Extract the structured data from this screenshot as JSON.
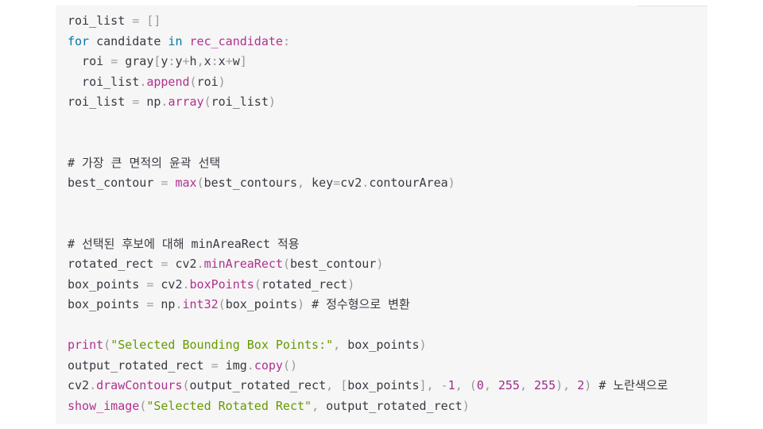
{
  "code": {
    "lines": [
      [
        {
          "c": "plain",
          "t": "roi_list "
        },
        {
          "c": "op",
          "t": "="
        },
        {
          "c": "plain",
          "t": " "
        },
        {
          "c": "punc",
          "t": "[]"
        }
      ],
      [
        {
          "c": "kw",
          "t": "for"
        },
        {
          "c": "plain",
          "t": " candidate "
        },
        {
          "c": "kw",
          "t": "in"
        },
        {
          "c": "plain",
          "t": " "
        },
        {
          "c": "fn",
          "t": "rec_candidate"
        },
        {
          "c": "punc",
          "t": ":"
        }
      ],
      [
        {
          "c": "plain",
          "t": "  roi "
        },
        {
          "c": "op",
          "t": "="
        },
        {
          "c": "plain",
          "t": " gray"
        },
        {
          "c": "punc",
          "t": "["
        },
        {
          "c": "plain",
          "t": "y"
        },
        {
          "c": "punc",
          "t": ":"
        },
        {
          "c": "plain",
          "t": "y"
        },
        {
          "c": "op",
          "t": "+"
        },
        {
          "c": "plain",
          "t": "h"
        },
        {
          "c": "punc",
          "t": ","
        },
        {
          "c": "plain",
          "t": "x"
        },
        {
          "c": "punc",
          "t": ":"
        },
        {
          "c": "plain",
          "t": "x"
        },
        {
          "c": "op",
          "t": "+"
        },
        {
          "c": "plain",
          "t": "w"
        },
        {
          "c": "punc",
          "t": "]"
        }
      ],
      [
        {
          "c": "plain",
          "t": "  roi_list"
        },
        {
          "c": "punc",
          "t": "."
        },
        {
          "c": "fn",
          "t": "append"
        },
        {
          "c": "punc",
          "t": "("
        },
        {
          "c": "plain",
          "t": "roi"
        },
        {
          "c": "punc",
          "t": ")"
        }
      ],
      [
        {
          "c": "plain",
          "t": "roi_list "
        },
        {
          "c": "op",
          "t": "="
        },
        {
          "c": "plain",
          "t": " np"
        },
        {
          "c": "punc",
          "t": "."
        },
        {
          "c": "fn",
          "t": "array"
        },
        {
          "c": "punc",
          "t": "("
        },
        {
          "c": "plain",
          "t": "roi_list"
        },
        {
          "c": "punc",
          "t": ")"
        }
      ],
      [],
      [],
      [
        {
          "c": "comment",
          "t": "# 가장 큰 면적의 윤곽 선택"
        }
      ],
      [
        {
          "c": "plain",
          "t": "best_contour "
        },
        {
          "c": "op",
          "t": "="
        },
        {
          "c": "plain",
          "t": " "
        },
        {
          "c": "fn",
          "t": "max"
        },
        {
          "c": "punc",
          "t": "("
        },
        {
          "c": "plain",
          "t": "best_contours"
        },
        {
          "c": "punc",
          "t": ","
        },
        {
          "c": "plain",
          "t": " key"
        },
        {
          "c": "op",
          "t": "="
        },
        {
          "c": "plain",
          "t": "cv2"
        },
        {
          "c": "punc",
          "t": "."
        },
        {
          "c": "plain",
          "t": "contourArea"
        },
        {
          "c": "punc",
          "t": ")"
        }
      ],
      [],
      [],
      [
        {
          "c": "comment",
          "t": "# 선택된 후보에 대해 minAreaRect 적용"
        }
      ],
      [
        {
          "c": "plain",
          "t": "rotated_rect "
        },
        {
          "c": "op",
          "t": "="
        },
        {
          "c": "plain",
          "t": " cv2"
        },
        {
          "c": "punc",
          "t": "."
        },
        {
          "c": "fn",
          "t": "minAreaRect"
        },
        {
          "c": "punc",
          "t": "("
        },
        {
          "c": "plain",
          "t": "best_contour"
        },
        {
          "c": "punc",
          "t": ")"
        }
      ],
      [
        {
          "c": "plain",
          "t": "box_points "
        },
        {
          "c": "op",
          "t": "="
        },
        {
          "c": "plain",
          "t": " cv2"
        },
        {
          "c": "punc",
          "t": "."
        },
        {
          "c": "fn",
          "t": "boxPoints"
        },
        {
          "c": "punc",
          "t": "("
        },
        {
          "c": "plain",
          "t": "rotated_rect"
        },
        {
          "c": "punc",
          "t": ")"
        }
      ],
      [
        {
          "c": "plain",
          "t": "box_points "
        },
        {
          "c": "op",
          "t": "="
        },
        {
          "c": "plain",
          "t": " np"
        },
        {
          "c": "punc",
          "t": "."
        },
        {
          "c": "fn",
          "t": "int32"
        },
        {
          "c": "punc",
          "t": "("
        },
        {
          "c": "plain",
          "t": "box_points"
        },
        {
          "c": "punc",
          "t": ")"
        },
        {
          "c": "plain",
          "t": " "
        },
        {
          "c": "comment",
          "t": "# 정수형으로 변환"
        }
      ],
      [],
      [
        {
          "c": "fn",
          "t": "print"
        },
        {
          "c": "punc",
          "t": "("
        },
        {
          "c": "str",
          "t": "\"Selected Bounding Box Points:\""
        },
        {
          "c": "punc",
          "t": ","
        },
        {
          "c": "plain",
          "t": " box_points"
        },
        {
          "c": "punc",
          "t": ")"
        }
      ],
      [
        {
          "c": "plain",
          "t": "output_rotated_rect "
        },
        {
          "c": "op",
          "t": "="
        },
        {
          "c": "plain",
          "t": " img"
        },
        {
          "c": "punc",
          "t": "."
        },
        {
          "c": "fn",
          "t": "copy"
        },
        {
          "c": "punc",
          "t": "()"
        }
      ],
      [
        {
          "c": "plain",
          "t": "cv2"
        },
        {
          "c": "punc",
          "t": "."
        },
        {
          "c": "fn",
          "t": "drawContours"
        },
        {
          "c": "punc",
          "t": "("
        },
        {
          "c": "plain",
          "t": "output_rotated_rect"
        },
        {
          "c": "punc",
          "t": ","
        },
        {
          "c": "plain",
          "t": " "
        },
        {
          "c": "punc",
          "t": "["
        },
        {
          "c": "plain",
          "t": "box_points"
        },
        {
          "c": "punc",
          "t": "],"
        },
        {
          "c": "plain",
          "t": " "
        },
        {
          "c": "op",
          "t": "-"
        },
        {
          "c": "num",
          "t": "1"
        },
        {
          "c": "punc",
          "t": ","
        },
        {
          "c": "plain",
          "t": " "
        },
        {
          "c": "punc",
          "t": "("
        },
        {
          "c": "num",
          "t": "0"
        },
        {
          "c": "punc",
          "t": ","
        },
        {
          "c": "plain",
          "t": " "
        },
        {
          "c": "num",
          "t": "255"
        },
        {
          "c": "punc",
          "t": ","
        },
        {
          "c": "plain",
          "t": " "
        },
        {
          "c": "num",
          "t": "255"
        },
        {
          "c": "punc",
          "t": "),"
        },
        {
          "c": "plain",
          "t": " "
        },
        {
          "c": "num",
          "t": "2"
        },
        {
          "c": "punc",
          "t": ")"
        },
        {
          "c": "plain",
          "t": " "
        },
        {
          "c": "comment",
          "t": "# 노란색으로"
        }
      ],
      [
        {
          "c": "fn",
          "t": "show_image"
        },
        {
          "c": "punc",
          "t": "("
        },
        {
          "c": "str",
          "t": "\"Selected Rotated Rect\""
        },
        {
          "c": "punc",
          "t": ","
        },
        {
          "c": "plain",
          "t": " output_rotated_rect"
        },
        {
          "c": "punc",
          "t": ")"
        }
      ]
    ]
  }
}
